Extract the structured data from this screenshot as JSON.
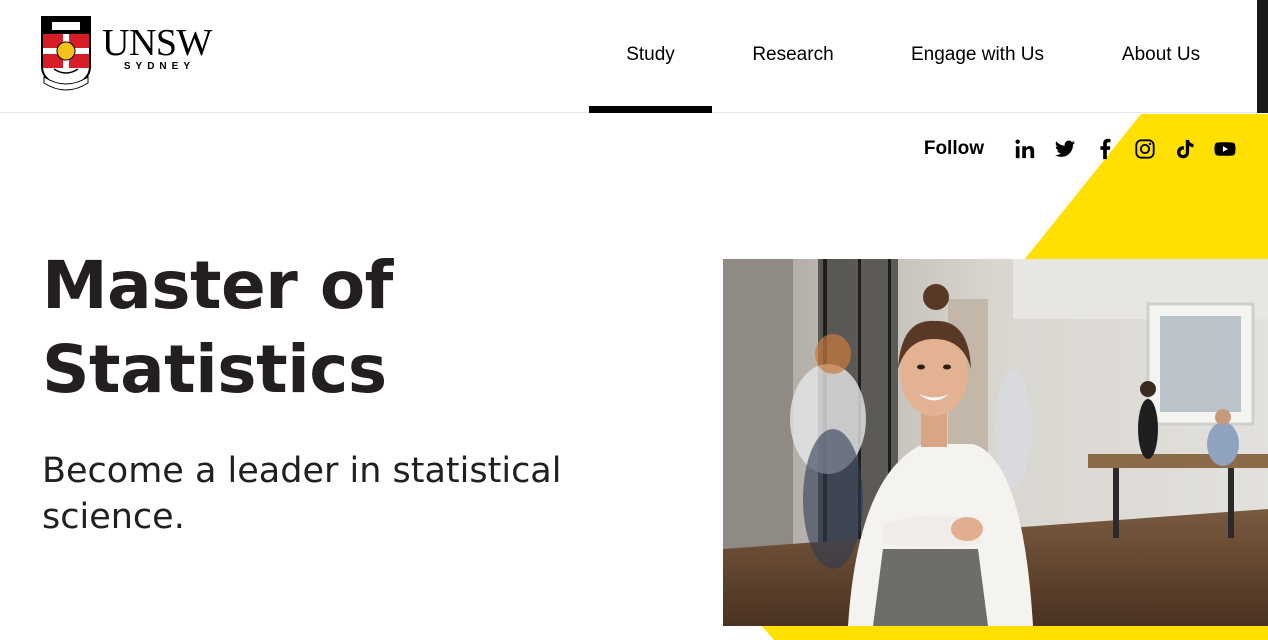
{
  "brand": {
    "name": "UNSW",
    "location": "SYDNEY",
    "motto": "MANU ET MENTE",
    "crest_book": "SCIENTIA",
    "colors": {
      "yellow": "#ffe000",
      "black": "#000000",
      "red": "#d71e28"
    }
  },
  "nav": {
    "items": [
      {
        "label": "Study",
        "active": true
      },
      {
        "label": "Research",
        "active": false
      },
      {
        "label": "Engage with Us",
        "active": false
      },
      {
        "label": "About Us",
        "active": false
      }
    ]
  },
  "follow": {
    "label": "Follow",
    "icons": [
      "linkedin-icon",
      "twitter-icon",
      "facebook-icon",
      "instagram-icon",
      "tiktok-icon",
      "youtube-icon"
    ]
  },
  "hero": {
    "title": "Master of Statistics",
    "subtitle": "Become a leader in statistical science.",
    "image_subject": "office-woman-smiling"
  }
}
